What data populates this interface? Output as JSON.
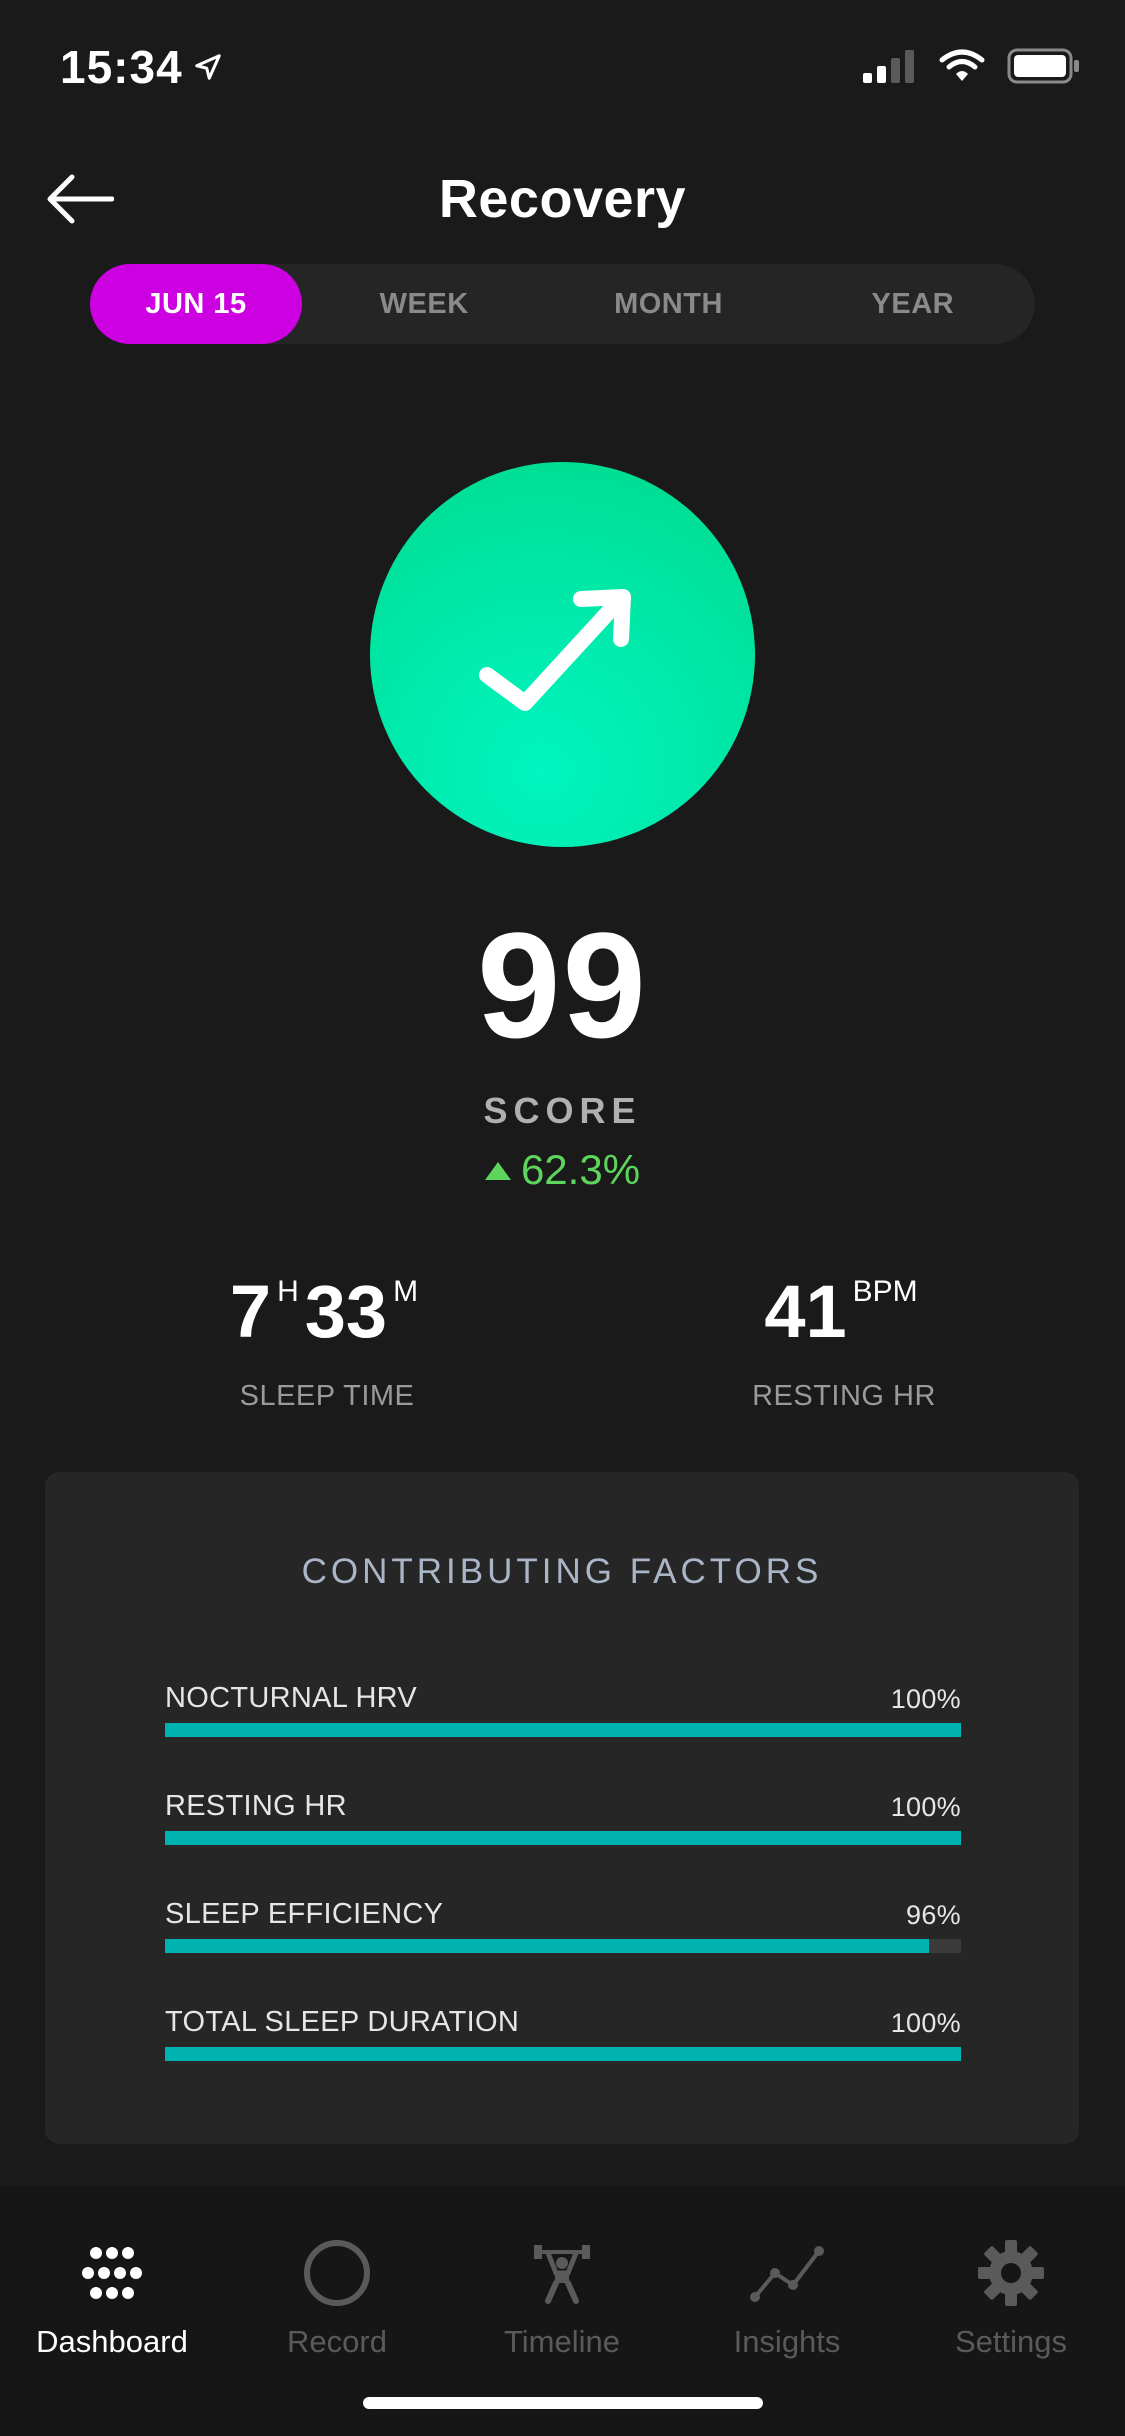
{
  "status_bar": {
    "time": "15:34",
    "location_icon": "location-arrow-icon",
    "signal_icon": "cellular-signal-icon",
    "wifi_icon": "wifi-icon",
    "battery_icon": "battery-icon"
  },
  "header": {
    "title": "Recovery",
    "back_icon": "arrow-left-icon"
  },
  "tabs": [
    {
      "label": "JUN 15",
      "active": true
    },
    {
      "label": "WEEK",
      "active": false
    },
    {
      "label": "MONTH",
      "active": false
    },
    {
      "label": "YEAR",
      "active": false
    }
  ],
  "hero": {
    "icon": "trend-up-arrow-icon",
    "score": "99",
    "score_label": "SCORE",
    "delta": "62.3%",
    "delta_direction": "up",
    "delta_color": "#5dd55d",
    "circle_color": "#00e6a4"
  },
  "stats": {
    "sleep_time": {
      "hours": "7",
      "hours_unit": "H",
      "minutes": "33",
      "minutes_unit": "M",
      "label": "SLEEP TIME"
    },
    "resting_hr": {
      "value": "41",
      "unit": "BPM",
      "label": "RESTING HR"
    }
  },
  "factors": {
    "title": "CONTRIBUTING FACTORS",
    "bar_color": "#00b3b0",
    "items": [
      {
        "name": "NOCTURNAL HRV",
        "percent_label": "100%",
        "value": 100
      },
      {
        "name": "RESTING HR",
        "percent_label": "100%",
        "value": 100
      },
      {
        "name": "SLEEP EFFICIENCY",
        "percent_label": "96%",
        "value": 96
      },
      {
        "name": "TOTAL SLEEP DURATION",
        "percent_label": "100%",
        "value": 100
      }
    ]
  },
  "nav": {
    "items": [
      {
        "label": "Dashboard",
        "icon": "dots-grid-icon",
        "active": true
      },
      {
        "label": "Record",
        "icon": "circle-icon",
        "active": false
      },
      {
        "label": "Timeline",
        "icon": "weightlifter-icon",
        "active": false
      },
      {
        "label": "Insights",
        "icon": "line-chart-icon",
        "active": false
      },
      {
        "label": "Settings",
        "icon": "gear-icon",
        "active": false
      }
    ]
  },
  "accent_color": "#cc00e0"
}
